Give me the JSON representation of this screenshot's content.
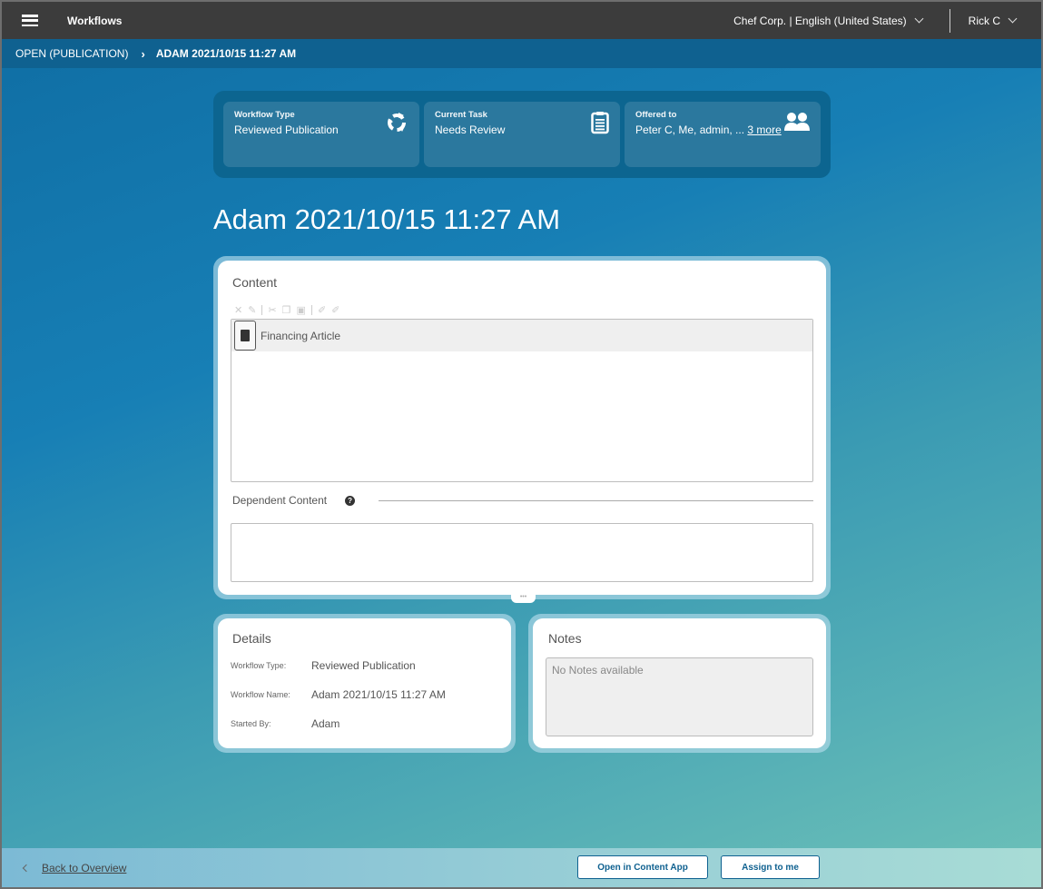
{
  "topbar": {
    "app_title": "Workflows",
    "tenant_locale": "Chef Corp. | English (United States)",
    "user": "Rick C"
  },
  "breadcrumb": {
    "parent": "OPEN (PUBLICATION)",
    "separator": "›",
    "current": "ADAM 2021/10/15 11:27 AM"
  },
  "summary": {
    "workflow_type": {
      "label": "Workflow Type",
      "value": "Reviewed Publication",
      "icon": "recycle-icon"
    },
    "current_task": {
      "label": "Current Task",
      "value": "Needs Review",
      "icon": "clipboard-icon"
    },
    "offered_to": {
      "label": "Offered to",
      "value": "Peter C, Me, admin, ...",
      "more_link": "3 more",
      "icon": "users-icon"
    }
  },
  "page_title": "Adam 2021/10/15 11:27 AM",
  "content_panel": {
    "title": "Content",
    "toolbar": [
      "remove-icon",
      "edit-icon",
      "cut-icon",
      "copy-icon",
      "paste-icon",
      "approve-icon",
      "disapprove-icon"
    ],
    "items": [
      {
        "label": "Financing Article",
        "icon": "document-icon"
      }
    ],
    "dependent_label": "Dependent Content",
    "help_glyph": "?",
    "resize_glyph": "•••"
  },
  "details_panel": {
    "title": "Details",
    "rows": [
      {
        "key": "Workflow Type:",
        "value": "Reviewed Publication"
      },
      {
        "key": "Workflow Name:",
        "value": "Adam 2021/10/15 11:27 AM"
      },
      {
        "key": "Started By:",
        "value": "Adam"
      }
    ]
  },
  "notes_panel": {
    "title": "Notes",
    "placeholder": "No Notes available"
  },
  "footer": {
    "back_label": "Back to Overview",
    "open_button": "Open in Content App",
    "assign_button": "Assign to me"
  },
  "colors": {
    "topbar": "#3c3c3c",
    "breadcrumb": "#0f6190",
    "accent": "#0f6190"
  }
}
